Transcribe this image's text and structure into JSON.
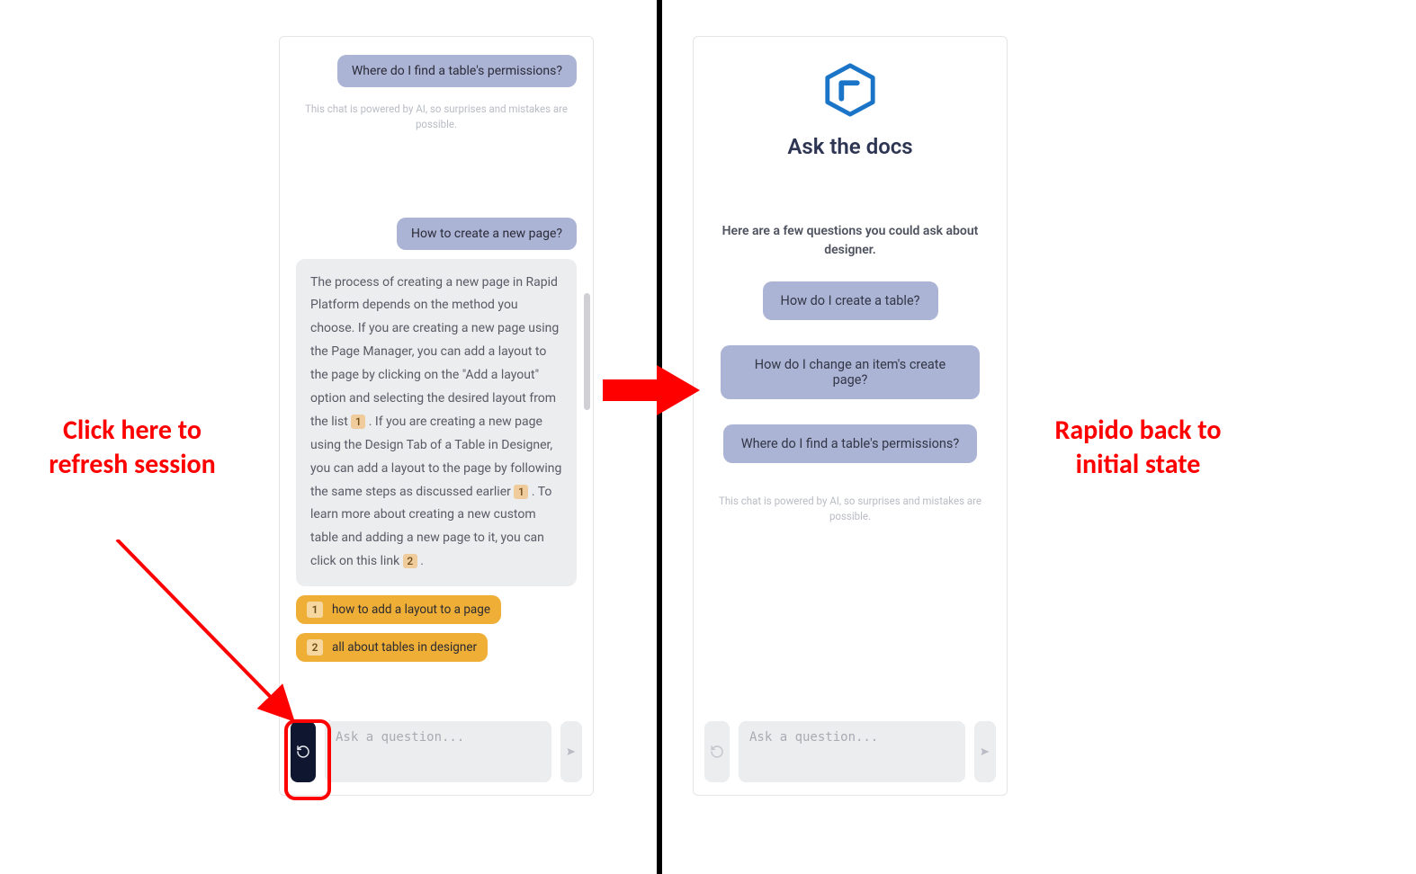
{
  "annotations": {
    "left_label": "Click here to refresh session",
    "right_label": "Rapido back to initial state"
  },
  "left_panel": {
    "user_msg_1": "Where do I find a table's permissions?",
    "disclaimer": "This chat is powered by AI, so surprises and mistakes are possible.",
    "user_msg_2": "How to create a new page?",
    "ai_answer_part1": "The process of creating a new page in Rapid Platform depends on the method you choose. If you are creating a new page using the Page Manager, you can add a layout to the page by clicking on the \"Add a layout\" option and selecting the desired layout from the list ",
    "ai_ref1": "1",
    "ai_answer_part2": " . If you are creating a new page using the Design Tab of a Table in Designer, you can add a layout to the page by following the same steps as discussed earlier ",
    "ai_ref2": "1",
    "ai_answer_part3": " . To learn more about creating a new custom table and adding a new page to it, you can click on this link ",
    "ai_ref3": "2",
    "ai_answer_part4": " .",
    "ref_links": [
      {
        "num": "1",
        "label": "how to add a layout to a page"
      },
      {
        "num": "2",
        "label": "all about tables in designer"
      }
    ],
    "input_placeholder": "Ask a question..."
  },
  "right_panel": {
    "title": "Ask the docs",
    "subtitle": "Here are a few questions you could ask about designer.",
    "suggestions": [
      "How do I create a table?",
      "How do I change an item's create page?",
      "Where do I find a table's permissions?"
    ],
    "disclaimer": "This chat is powered by AI, so surprises and mistakes are possible.",
    "input_placeholder": "Ask a question..."
  }
}
